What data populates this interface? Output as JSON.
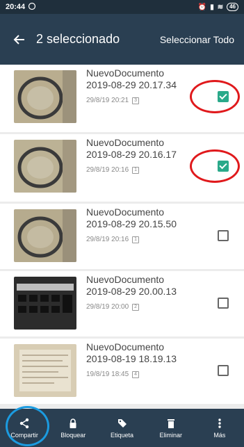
{
  "status": {
    "time": "20:44",
    "battery": "46"
  },
  "header": {
    "title": "2 seleccionado",
    "select_all": "Seleccionar Todo"
  },
  "documents": [
    {
      "name": "NuevoDocumento",
      "stamp": "2019-08-29 20.17.34",
      "date": "29/8/19 20:21",
      "pages": "3",
      "checked": true
    },
    {
      "name": "NuevoDocumento",
      "stamp": "2019-08-29 20.16.17",
      "date": "29/8/19 20:16",
      "pages": "1",
      "checked": true
    },
    {
      "name": "NuevoDocumento",
      "stamp": "2019-08-29 20.15.50",
      "date": "29/8/19 20:16",
      "pages": "1",
      "checked": false
    },
    {
      "name": "NuevoDocumento",
      "stamp": "2019-08-29 20.00.13",
      "date": "29/8/19 20:00",
      "pages": "2",
      "checked": false
    },
    {
      "name": "NuevoDocumento",
      "stamp": "2019-08-19 18.19.13",
      "date": "19/8/19 18:45",
      "pages": "4",
      "checked": false
    }
  ],
  "toolbar": {
    "share": "Compartir",
    "lock": "Bloquear",
    "tag": "Etiqueta",
    "delete": "Eliminar",
    "more": "Más"
  },
  "icons": [
    "whatsapp-icon",
    "back-arrow-icon",
    "share-icon",
    "lock-icon",
    "tag-icon",
    "trash-icon",
    "more-vert-icon"
  ],
  "colors": {
    "appbar": "#2a3f52",
    "checked": "#2aa98a",
    "annotation_red": "#e0191c",
    "annotation_blue": "#1b9be0"
  }
}
